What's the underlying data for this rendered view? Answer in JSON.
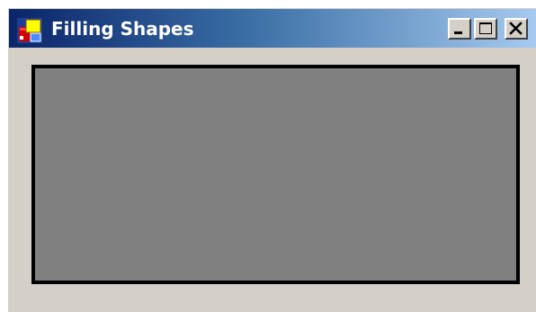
{
  "window": {
    "title": "Filling Shapes",
    "icon": "app-window-icon",
    "controls": {
      "minimize_icon": "minimize-icon",
      "maximize_icon": "maximize-icon",
      "close_icon": "close-icon"
    }
  },
  "colors": {
    "titlebar_start": "#0a246a",
    "titlebar_end": "#a6caf0",
    "window_background": "#d4d0c8",
    "rectangle_fill": "#808080",
    "rectangle_border": "#000000"
  }
}
